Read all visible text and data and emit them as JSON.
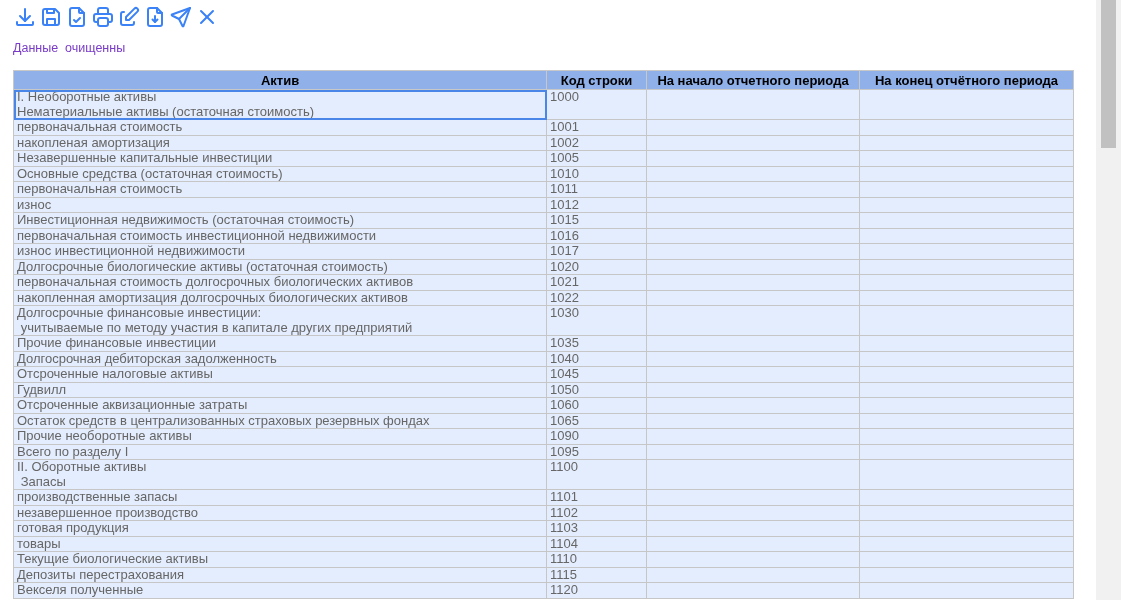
{
  "toolbar": [
    {
      "kind": "download"
    },
    {
      "kind": "save"
    },
    {
      "kind": "file-check"
    },
    {
      "kind": "print"
    },
    {
      "kind": "edit"
    },
    {
      "kind": "file-download"
    },
    {
      "kind": "send"
    },
    {
      "kind": "close"
    }
  ],
  "status_message": "Данные  очищенны",
  "table": {
    "columns": [
      "Актив",
      "Код строки",
      "На начало отчетного периода",
      "На конец отчётного периода"
    ],
    "rows": [
      {
        "label": "I. Необоротные активы\nНематериальные активы (остаточная стоимость)",
        "code": "1000",
        "selected": true
      },
      {
        "label": "первоначальная стоимость",
        "code": "1001",
        "selected": false
      },
      {
        "label": "накопленая амортизация",
        "code": "1002",
        "selected": false
      },
      {
        "label": "Незавершенные капитальные инвестиции",
        "code": "1005",
        "selected": false
      },
      {
        "label": "Основные средства (остаточная стоимость)",
        "code": "1010",
        "selected": false
      },
      {
        "label": "первоначальная стоимость",
        "code": "1011",
        "selected": false
      },
      {
        "label": "износ",
        "code": "1012",
        "selected": false
      },
      {
        "label": "Инвестиционная недвижимость (остаточная стоимость)",
        "code": "1015",
        "selected": false
      },
      {
        "label": "первоначальная стоимость инвестиционной недвижимости",
        "code": "1016",
        "selected": false
      },
      {
        "label": "износ инвестиционной недвижимости",
        "code": "1017",
        "selected": false
      },
      {
        "label": "Долгосрочные биологические активы (остаточная стоимость)",
        "code": "1020",
        "selected": false
      },
      {
        "label": "первоначальная стоимость долгосрочных биологических активов",
        "code": "1021",
        "selected": false
      },
      {
        "label": "накопленная амортизация долгосрочных биологических активов",
        "code": "1022",
        "selected": false
      },
      {
        "label": "Долгосрочные финансовые инвестиции:\n учитываемые по методу участия в капитале других предприятий",
        "code": "1030",
        "selected": false
      },
      {
        "label": "Прочие финансовые инвестиции",
        "code": "1035",
        "selected": false
      },
      {
        "label": "Долгосрочная дебиторская задолженность",
        "code": "1040",
        "selected": false
      },
      {
        "label": "Отсроченные налоговые активы",
        "code": "1045",
        "selected": false
      },
      {
        "label": "Гудвилл",
        "code": "1050",
        "selected": false
      },
      {
        "label": "Отсроченные аквизационные затраты",
        "code": "1060",
        "selected": false
      },
      {
        "label": "Остаток средств в централизованных страховых резервных фондах",
        "code": "1065",
        "selected": false
      },
      {
        "label": "Прочие необоротные активы",
        "code": "1090",
        "selected": false
      },
      {
        "label": "Всего по разделу I",
        "code": "1095",
        "selected": false
      },
      {
        "label": "II. Оборотные активы\n Запасы",
        "code": "1100",
        "selected": false
      },
      {
        "label": "производственные запасы",
        "code": "1101",
        "selected": false
      },
      {
        "label": "незавершенное производство",
        "code": "1102",
        "selected": false
      },
      {
        "label": "готовая продукция",
        "code": "1103",
        "selected": false
      },
      {
        "label": "товары",
        "code": "1104",
        "selected": false
      },
      {
        "label": "Текущие биологические активы",
        "code": "1110",
        "selected": false
      },
      {
        "label": "Депозиты перестрахования",
        "code": "1115",
        "selected": false
      },
      {
        "label": "Векселя полученные",
        "code": "1120",
        "selected": false
      }
    ]
  }
}
